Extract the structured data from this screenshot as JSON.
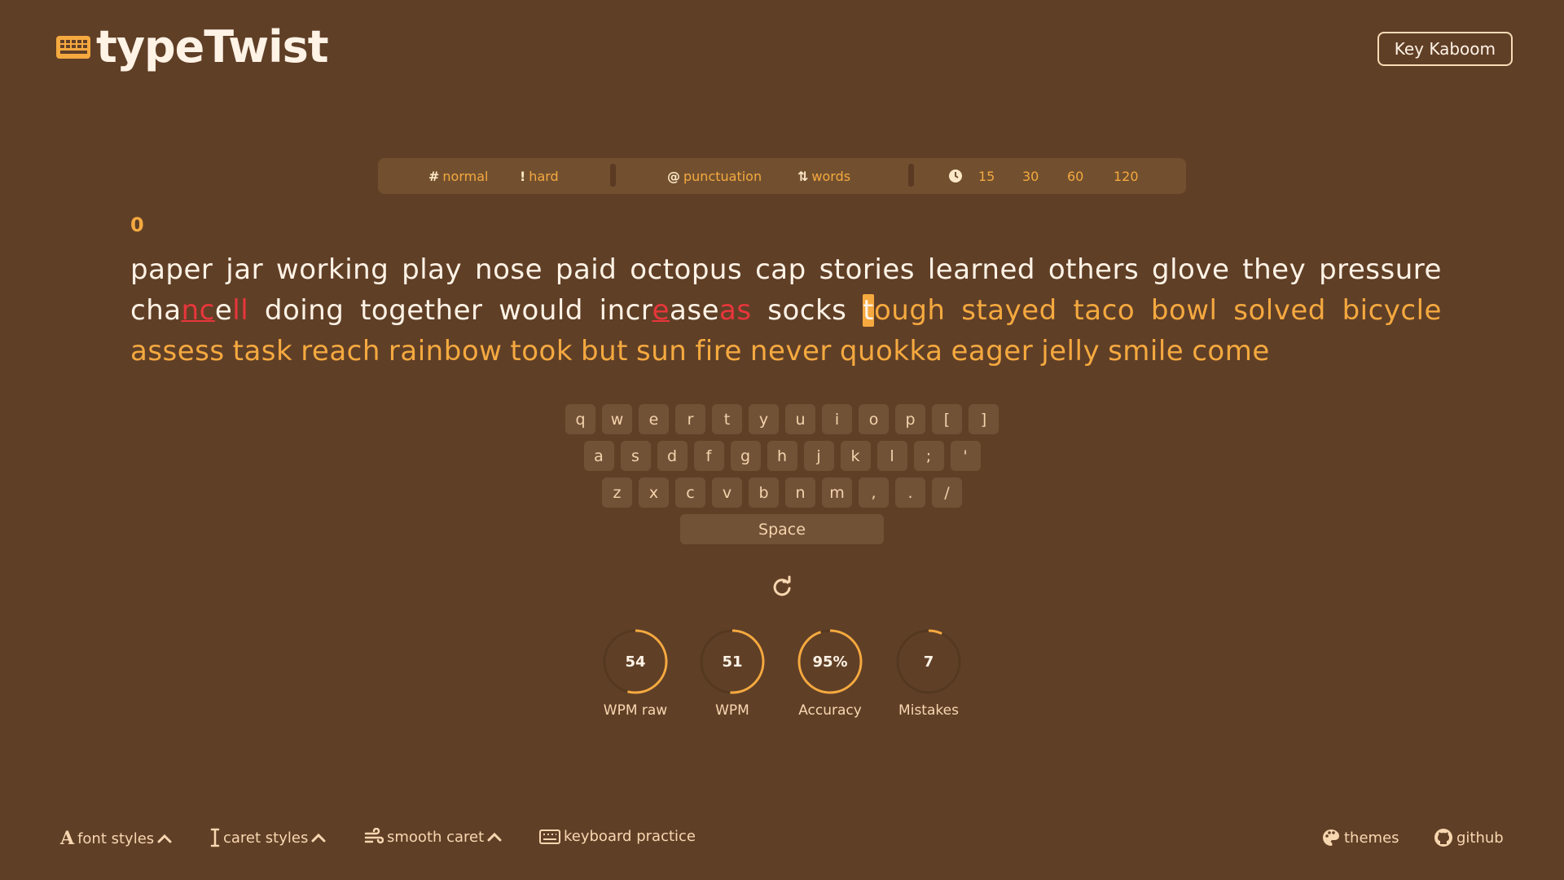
{
  "app": {
    "name": "typeTwist",
    "logo_icon": "keyboard-icon"
  },
  "header": {
    "key_button": "Key Kaboom"
  },
  "menu": {
    "normal": {
      "glyph": "#",
      "label": "normal"
    },
    "hard": {
      "glyph": "!",
      "label": "hard"
    },
    "punctuation": {
      "glyph": "@",
      "label": "punctuation"
    },
    "words": {
      "glyph": "⇅",
      "label": "words"
    },
    "times": [
      "15",
      "30",
      "60",
      "120"
    ]
  },
  "test": {
    "counter": "0",
    "line1": [
      "paper",
      "jar",
      "working",
      "play",
      "nose",
      "paid",
      "octopus",
      "cap",
      "stories",
      "learned",
      "others",
      "glove",
      "they",
      "pressure"
    ],
    "line2": {
      "w1_a": "cha",
      "w1_b": "nc",
      "w1_c": "e",
      "w1_d": "ll",
      "w2": "doing",
      "w3": "together",
      "w4": "would",
      "w5_a": "incr",
      "w5_b": "e",
      "w5_c": "ase",
      "w5_d": "as",
      "w6": "socks",
      "w7_a": "t",
      "w7_b": "ough",
      "rest": [
        "stayed",
        "taco",
        "bowl",
        "solved",
        "bicycle"
      ]
    },
    "line3": [
      "assess",
      "task",
      "reach",
      "rainbow",
      "took",
      "but",
      "sun",
      "fire",
      "never",
      "quokka",
      "eager",
      "jelly",
      "smile",
      "come"
    ]
  },
  "keyboard": {
    "row1": [
      "q",
      "w",
      "e",
      "r",
      "t",
      "y",
      "u",
      "i",
      "o",
      "p",
      "[",
      "]"
    ],
    "row2": [
      "a",
      "s",
      "d",
      "f",
      "g",
      "h",
      "j",
      "k",
      "l",
      ";",
      "'"
    ],
    "row3": [
      "z",
      "x",
      "c",
      "v",
      "b",
      "n",
      "m",
      ",",
      ".",
      "/"
    ],
    "space": "Space"
  },
  "stats": [
    {
      "value": "54",
      "label": "WPM raw",
      "progress": 0.54
    },
    {
      "value": "51",
      "label": "WPM",
      "progress": 0.51
    },
    {
      "value": "95%",
      "label": "Accuracy",
      "progress": 0.95
    },
    {
      "value": "7",
      "label": "Mistakes",
      "progress": 0.07
    }
  ],
  "footer": {
    "font_styles": "font styles",
    "caret_styles": "caret styles",
    "smooth_caret": "smooth caret",
    "keyboard_practice": "keyboard practice",
    "themes": "themes",
    "github": "github"
  },
  "colors": {
    "background": "#603f27",
    "accent": "#f5a93f",
    "error": "#e8363b",
    "text": "#fff3e6"
  }
}
